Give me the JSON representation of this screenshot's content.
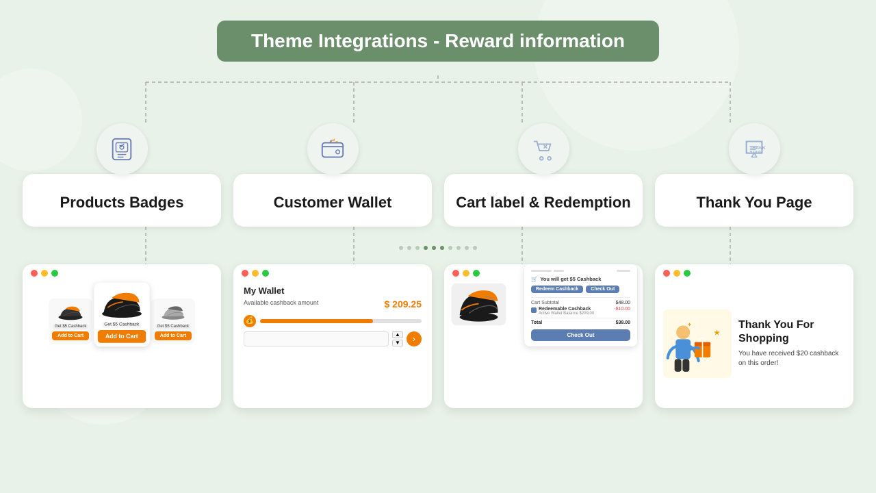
{
  "page": {
    "title": "Theme Integrations - Reward information",
    "bg_color": "#ddeedd"
  },
  "features": [
    {
      "id": "products-badges",
      "label": "Products Badges",
      "icon_type": "badge"
    },
    {
      "id": "customer-wallet",
      "label": "Customer Wallet",
      "icon_type": "wallet"
    },
    {
      "id": "cart-label",
      "label": "Cart label & Redemption",
      "icon_type": "cart"
    },
    {
      "id": "thank-you-page",
      "label": "Thank You Page",
      "icon_type": "thankyou"
    }
  ],
  "wallet_preview": {
    "title": "My Wallet",
    "available_label": "Available cashback amount",
    "amount": "$ 209.25"
  },
  "thankyou_preview": {
    "heading": "Thank You For Shopping",
    "subtext": "You have received $20 cashback on this order!"
  },
  "cart_preview": {
    "cashback_msg": "You will get $5 Cashback",
    "redeem_btn": "Redeem Cashback",
    "checkout_btn": "Check Out",
    "subtotal_label": "Cart Subtotal",
    "subtotal_value": "$48.00",
    "redeemable_label": "Redeemable Cashback",
    "redeemable_sub": "Active Wallet Balance $209.00",
    "redeemable_value": "-$10.00",
    "total_label": "Total",
    "total_value": "$38.00",
    "final_checkout": "Check Out"
  },
  "products_preview": {
    "cashback1": "Get $5 Cashback",
    "cashback2": "Get $5 Cashback",
    "add_to_cart": "Add to Cart",
    "add_btn1": "Add to Cart",
    "add_btn2": "Add to Cart"
  },
  "dots": [
    1,
    2,
    3,
    4,
    5,
    6,
    7,
    8,
    9,
    10
  ]
}
